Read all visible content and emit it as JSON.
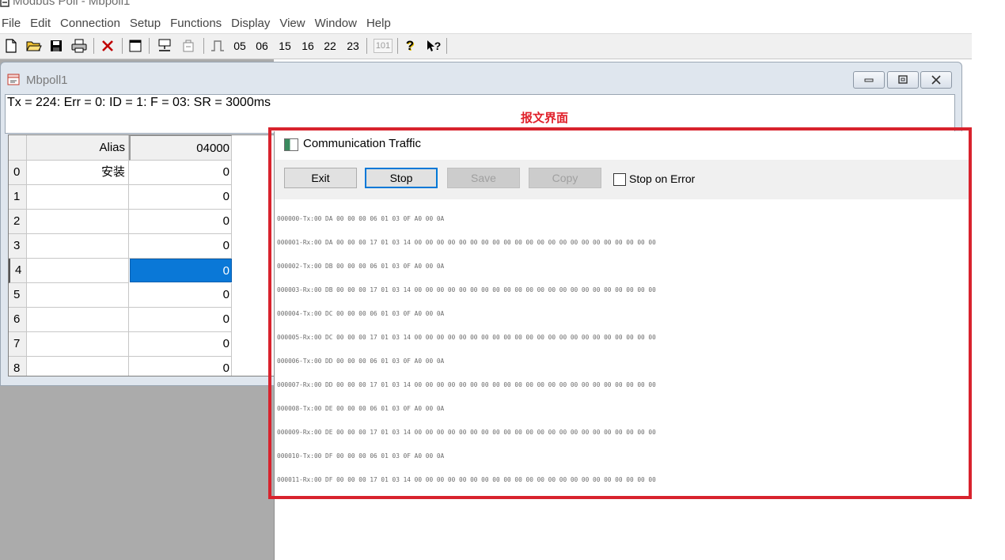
{
  "app": {
    "title": "Modbus Poll - Mbpoll1"
  },
  "menu": [
    "File",
    "Edit",
    "Connection",
    "Setup",
    "Functions",
    "Display",
    "View",
    "Window",
    "Help"
  ],
  "toolbar": {
    "icons": [
      "new-file-icon",
      "open-folder-icon",
      "save-icon",
      "print-icon",
      "delete-icon",
      "window-icon",
      "connect-icon",
      "disconnect-icon",
      "pulse-icon"
    ],
    "function_codes": [
      "05",
      "06",
      "15",
      "16",
      "22",
      "23"
    ],
    "disabled_code": "101",
    "help": "?",
    "context_help": "?"
  },
  "child_window": {
    "title": "Mbpoll1",
    "status": "Tx = 224: Err = 0: ID = 1: F = 03: SR = 3000ms",
    "grid": {
      "headers": {
        "alias": "Alias",
        "address": "04000"
      },
      "rows": [
        {
          "index": "0",
          "alias": "安装",
          "value": "0"
        },
        {
          "index": "1",
          "alias": "",
          "value": "0"
        },
        {
          "index": "2",
          "alias": "",
          "value": "0"
        },
        {
          "index": "3",
          "alias": "",
          "value": "0"
        },
        {
          "index": "4",
          "alias": "",
          "value": "0"
        },
        {
          "index": "5",
          "alias": "",
          "value": "0"
        },
        {
          "index": "6",
          "alias": "",
          "value": "0"
        },
        {
          "index": "7",
          "alias": "",
          "value": "0"
        },
        {
          "index": "8",
          "alias": "",
          "value": "0"
        }
      ],
      "selected_row": 4
    }
  },
  "annotation": {
    "label": "报文界面",
    "color": "#d8232d"
  },
  "traffic": {
    "title": "Communication Traffic",
    "buttons": {
      "exit": "Exit",
      "stop": "Stop",
      "save": "Save",
      "copy": "Copy"
    },
    "stop_on_error": "Stop on Error",
    "log": [
      "000000-Tx:00 DA 00 00 00 06 01 03 0F A0 00 0A",
      "000001-Rx:00 DA 00 00 00 17 01 03 14 00 00 00 00 00 00 00 00 00 00 00 00 00 00 00 00 00 00 00 00 00 00",
      "000002-Tx:00 DB 00 00 00 06 01 03 0F A0 00 0A",
      "000003-Rx:00 DB 00 00 00 17 01 03 14 00 00 00 00 00 00 00 00 00 00 00 00 00 00 00 00 00 00 00 00 00 00",
      "000004-Tx:00 DC 00 00 00 06 01 03 0F A0 00 0A",
      "000005-Rx:00 DC 00 00 00 17 01 03 14 00 00 00 00 00 00 00 00 00 00 00 00 00 00 00 00 00 00 00 00 00 00",
      "000006-Tx:00 DD 00 00 00 06 01 03 0F A0 00 0A",
      "000007-Rx:00 DD 00 00 00 17 01 03 14 00 00 00 00 00 00 00 00 00 00 00 00 00 00 00 00 00 00 00 00 00 00",
      "000008-Tx:00 DE 00 00 00 06 01 03 0F A0 00 0A",
      "000009-Rx:00 DE 00 00 00 17 01 03 14 00 00 00 00 00 00 00 00 00 00 00 00 00 00 00 00 00 00 00 00 00 00",
      "000010-Tx:00 DF 00 00 00 06 01 03 0F A0 00 0A",
      "000011-Rx:00 DF 00 00 00 17 01 03 14 00 00 00 00 00 00 00 00 00 00 00 00 00 00 00 00 00 00 00 00 00 00"
    ]
  }
}
